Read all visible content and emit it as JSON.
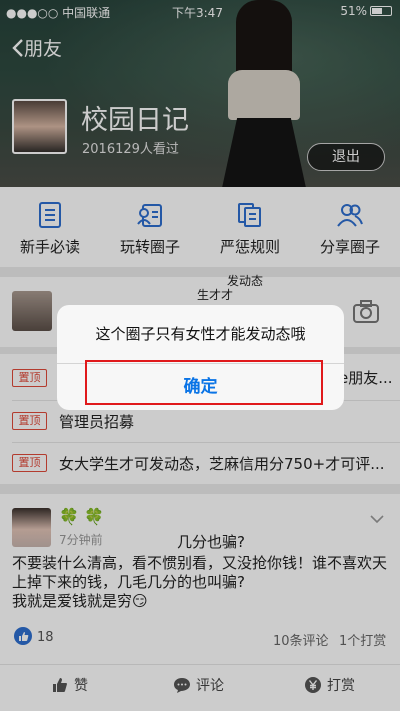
{
  "status_bar": {
    "carrier": "●●●○○ 中国联通",
    "time": "下午3:47",
    "battery": "51%"
  },
  "nav": {
    "back_label": "朋友"
  },
  "circle": {
    "title": "校园日记",
    "views": "2016129人看过",
    "exit_label": "退出"
  },
  "menu": [
    {
      "label": "新手必读",
      "icon": "document-icon"
    },
    {
      "label": "玩转圈子",
      "icon": "contact-card-icon"
    },
    {
      "label": "严惩规则",
      "icon": "rules-icon"
    },
    {
      "label": "分享圈子",
      "icon": "people-icon"
    }
  ],
  "stray_text": {
    "line1": "发动态",
    "line2": "生才才"
  },
  "pinned": [
    {
      "tag": "置顶",
      "text": "",
      "peek": "e朋友..."
    },
    {
      "tag": "置顶",
      "text": "管理员招募"
    },
    {
      "tag": "置顶",
      "text": "女大学生才可发动态，芝麻信用分750+才可评..."
    }
  ],
  "post": {
    "username": "🍀 🍀",
    "time": "7分钟前",
    "floating": "几分也骗?",
    "body": "不要装什么清高，看不惯别看，又没抢你钱！谁不喜欢天上掉下来的钱，几毛几分的也叫骗?\n我就是爱钱就是穷😏",
    "likes": "18",
    "comments": "10条评论",
    "tips": "1个打赏"
  },
  "actions": {
    "like": "赞",
    "comment": "评论",
    "tip": "打赏"
  },
  "dialog": {
    "message": "这个圈子只有女性才能发动态哦",
    "confirm": "确定"
  },
  "colors": {
    "accent": "#0a74e6",
    "pin": "#e04a3a",
    "highlight": "#e0191b",
    "icon_blue": "#2d6fd0"
  }
}
